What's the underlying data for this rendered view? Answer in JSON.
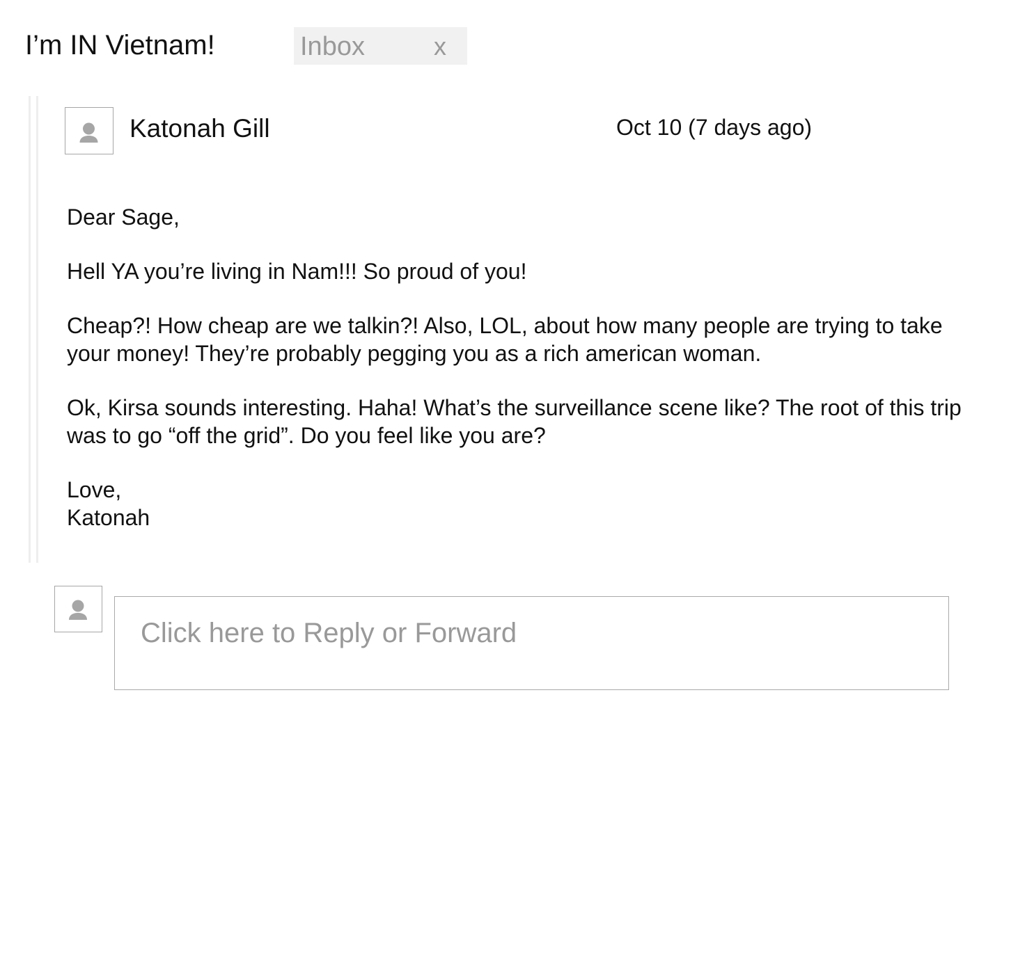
{
  "conversation": {
    "subject": "I’m IN Vietnam!",
    "label": {
      "name": "Inbox",
      "remove_glyph": "x"
    }
  },
  "message": {
    "sender_name": "Katonah Gill",
    "date": "Oct 10 (7 days ago)",
    "avatar_icon": "person-placeholder-icon",
    "body": {
      "greeting": "Dear Sage,",
      "paragraphs": [
        "Hell YA you’re living in Nam!!! So proud of you!",
        "Cheap?! How cheap are we talkin?! Also, LOL, about how many people are trying to take your money! They’re probably pegging you as a rich american woman.",
        "Ok, Kirsa sounds interesting. Haha! What’s the surveillance scene like? The root of this trip was to go “off the grid”. Do you feel like you are?"
      ],
      "closing": "Love,",
      "signature": "Katonah"
    }
  },
  "reply": {
    "placeholder": "Click here to Reply or Forward",
    "avatar_icon": "person-placeholder-icon"
  },
  "colors": {
    "text": "#111111",
    "muted_text": "#999999",
    "chip_background": "#f1f1f2",
    "border": "#a6a6a6",
    "thread_bar": "#eeeeee"
  }
}
